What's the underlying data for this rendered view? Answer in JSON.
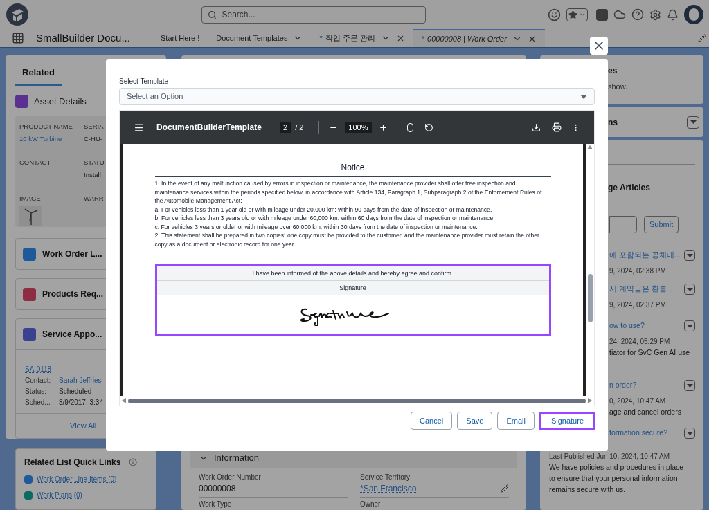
{
  "header": {
    "search": {
      "placeholder": "Search..."
    }
  },
  "nav": {
    "app_name": "SmallBuilder Docu...",
    "tabs": [
      {
        "label": "Start Here !",
        "selected": false,
        "dropdown": false,
        "closable": false
      },
      {
        "label": "Document Templates",
        "selected": false,
        "dropdown": true,
        "closable": false
      },
      {
        "label": "작업 주문 관리",
        "mark": "*",
        "selected": false,
        "dropdown": true,
        "closable": true
      },
      {
        "label": "00000008 | Work Order",
        "mark": "*",
        "selected": true,
        "dropdown": true,
        "closable": true
      }
    ]
  },
  "left": {
    "tab": {
      "label": "Related",
      "selected": true
    },
    "asset": {
      "title": "Asset Details",
      "fields": [
        {
          "label": "PRODUCT NAME",
          "value": "10 kW Turbine",
          "link": true
        },
        {
          "label": "SERIA",
          "value": "C-HU-",
          "link": false
        },
        {
          "label": "CONTACT"
        },
        {
          "label": "STATU",
          "value": "Install",
          "link": false
        },
        {
          "label": "IMAGE",
          "image": true
        },
        {
          "label": "WARR"
        }
      ]
    },
    "cards": [
      {
        "title": "Work Order L...",
        "color": "#1e5a99"
      },
      {
        "title": "Products Req...",
        "color": "#8e2c43"
      },
      {
        "title": "Service Appo...",
        "color": "#3a428f"
      }
    ],
    "appointment": {
      "link": "SA-0118",
      "rows": [
        {
          "label": "Contact:",
          "value": "Sarah Jeffries",
          "link": true
        },
        {
          "label": "Status:",
          "value": "Scheduled",
          "link": false
        },
        {
          "label": "Sched...",
          "value": "3/9/2017, 3:34",
          "link": false
        }
      ],
      "view_all": "View All"
    },
    "quick_links": {
      "title": "Related List Quick Links",
      "links": [
        {
          "label": "Work Order Line Items (0)",
          "color": "#1e5a99"
        },
        {
          "label": "Work Plans (0)",
          "color": "#0b6a62"
        }
      ]
    }
  },
  "information": {
    "title": "Information",
    "fields": [
      {
        "label": "Work Order Number",
        "value": "00000008",
        "link": false,
        "editable": false
      },
      {
        "label": "Service Territory",
        "value": "*San Francisco",
        "link": true,
        "editable": true
      },
      {
        "label": "Work Type"
      },
      {
        "label": "Owner"
      }
    ]
  },
  "right": {
    "panel1": {
      "title": "es",
      "text": "show."
    },
    "panel2": {
      "title": "ns"
    },
    "articles": {
      "title": "ge Articles",
      "submit": "Submit",
      "items": [
        {
          "title": "에 포함되는 공채매...",
          "date": "9, 2024, 02:38 PM"
        },
        {
          "title": "시 계약금은 환불 ...",
          "date": "9, 2024, 02:37 PM"
        },
        {
          "title": "ow to use?",
          "date": "24, 2024, 05:29 PM",
          "summary": "tiator for SvC Gen AI use"
        },
        {
          "title": "n order?",
          "date": "0, 2024, 10:47 AM",
          "summary": "age and cancel orders"
        },
        {
          "title": "formation secure?",
          "date": "Last Published Jun 10, 2024, 10:47 AM",
          "summary": "We have policies and procedures in place to ensure that your personal information remains secure with us."
        }
      ]
    }
  },
  "modal": {
    "template": {
      "label": "Select Template",
      "placeholder": "Select an Option"
    },
    "viewer": {
      "title": "DocumentBuilderTemplate",
      "page": "2",
      "pages": "/ 2",
      "zoom": "100%"
    },
    "document": {
      "heading": "Notice",
      "paragraphs": [
        "1. In the event of any malfunction caused by errors in inspection or maintenance, the maintenance provider shall offer free inspection and maintenance services within the periods specified below, in accordance with Article 134, Paragraph 1, Subparagraph 2 of the Enforcement Rules of the Automobile Management Act:",
        "a. For vehicles less than 1 year old or with mileage under 20,000 km: within 90 days from the date of inspection or maintenance.",
        "b. For vehicles less than 3 years old or with mileage under 60,000 km: within 60 days from the date of inspection or maintenance.",
        "c. For vehicles 3 years or older or with mileage over 60,000 km: within 30 days from the date of inspection or maintenance.",
        "2. This statement shall be prepared in two copies: one copy must be provided to the customer, and the maintenance provider must retain the other copy as a document or electronic record for one year."
      ],
      "table": {
        "highlighted": true,
        "rows": [
          "I have been informed of the above details and hereby agree and confirm.",
          "Signature"
        ]
      }
    },
    "buttons": [
      {
        "label": "Cancel",
        "highlighted": false
      },
      {
        "label": "Save",
        "highlighted": false
      },
      {
        "label": "Email",
        "highlighted": false
      },
      {
        "label": "Signature",
        "highlighted": true
      }
    ]
  }
}
